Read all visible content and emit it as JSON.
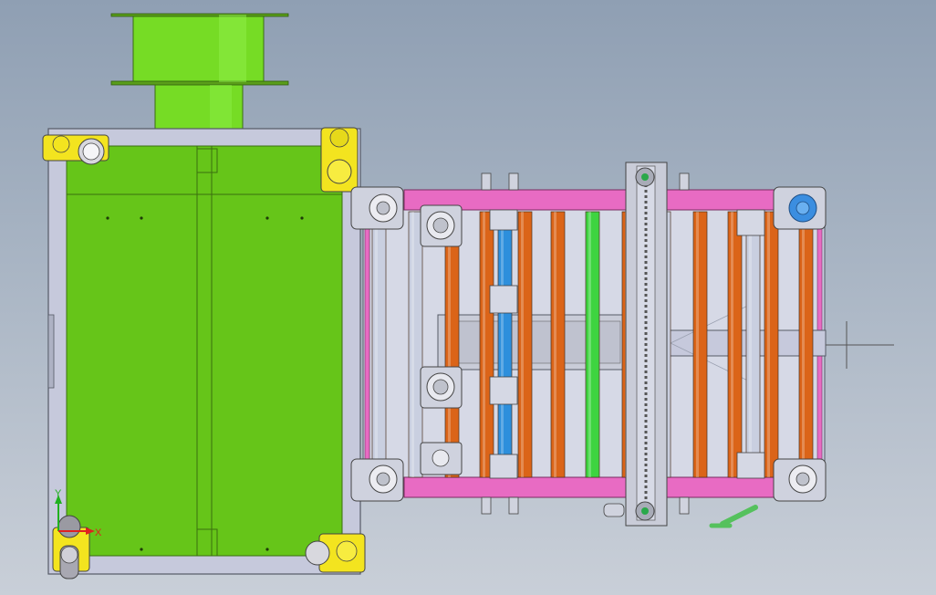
{
  "scene": {
    "background_top": "#8f9fb3",
    "background_bottom": "#c9cfd8",
    "colors": {
      "cabinet_green": "#66c519",
      "reel_green": "#76dc25",
      "frame_gray": "#c6c9dc",
      "caster_yellow": "#f3e41f",
      "pink_rail": "#e86bc3",
      "orange_roller": "#db6418",
      "blue_roller": "#2d8fdc",
      "green_roller": "#3ed440",
      "gray_roller": "#c9cfe0",
      "blue_wheel": "#3b8ee0",
      "handle_green": "#55c15d"
    },
    "roller_sequence": [
      "gray",
      "gray",
      "orange",
      "orange",
      "blue",
      "orange",
      "orange",
      "green",
      "orange",
      "gray",
      "orange",
      "orange",
      "gray",
      "orange",
      "orange"
    ]
  },
  "axis_triad": {
    "x_label": "X",
    "y_label": "Y",
    "x_color": "#e02020",
    "y_color": "#20b020"
  }
}
